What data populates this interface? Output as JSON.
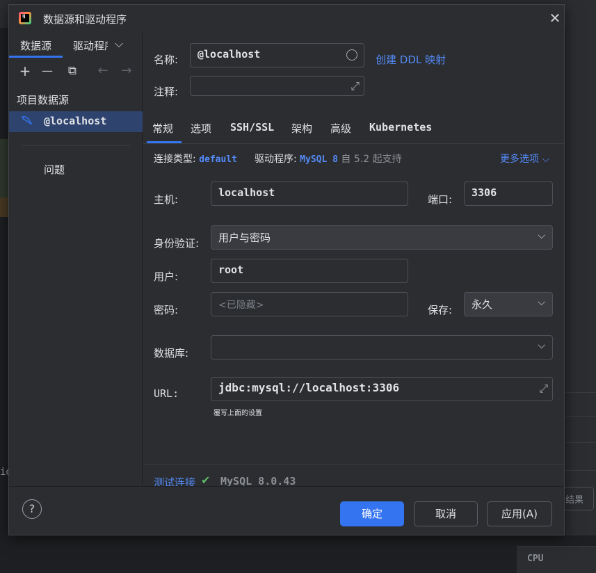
{
  "background": {
    "left_text": "id",
    "result_button": "结果",
    "cpu_label": "CPU"
  },
  "dialog": {
    "title": "数据源和驱动程序",
    "close_icon": "close-icon",
    "left": {
      "tab_datasources": "数据源",
      "tab_drivers": "驱动程序",
      "toolbar": {
        "add": "+",
        "remove": "—",
        "duplicate": "⧉",
        "back": "←",
        "forward": "→"
      },
      "group_label": "项目数据源",
      "selected_item": "@localhost",
      "problems": "问题"
    },
    "form": {
      "name_label": "名称:",
      "name_value": "@localhost",
      "ddl_link": "创建 DDL 映射",
      "comment_label": "注释:",
      "comment_value": "",
      "tabs": [
        "常规",
        "选项",
        "SSH/SSL",
        "架构",
        "高级",
        "Kubernetes"
      ],
      "active_tab": "常规",
      "connection_type_label": "连接类型:",
      "connection_type_value": "default",
      "driver_label": "驱动程序:",
      "driver_value": "MySQL 8",
      "driver_since": "自 5.2 起支持",
      "more_options": "更多选项",
      "host_label": "主机:",
      "host_value": "localhost",
      "port_label": "端口:",
      "port_value": "3306",
      "auth_label": "身份验证:",
      "auth_value": "用户与密码",
      "user_label": "用户:",
      "user_value": "root",
      "password_label": "密码:",
      "password_placeholder": "<已隐藏>",
      "save_label": "保存:",
      "save_value": "永久",
      "database_label": "数据库:",
      "database_value": "",
      "url_label": "URL:",
      "url_value": "jdbc:mysql://localhost:3306",
      "url_hint": "覆写上面的设置",
      "test_link": "测试连接",
      "test_result": "MySQL 8.0.43"
    },
    "footer": {
      "help": "?",
      "ok": "确定",
      "cancel": "取消",
      "apply": "应用(A)"
    }
  }
}
